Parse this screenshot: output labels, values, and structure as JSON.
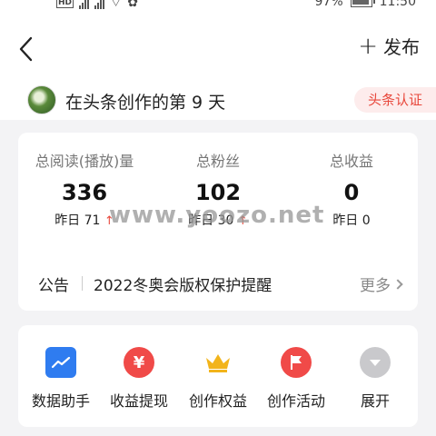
{
  "status": {
    "battery": "97%",
    "time": "11:50"
  },
  "header": {
    "publish_label": "发布"
  },
  "day": {
    "text": "在头条创作的第 9 天",
    "badge": "头条认证"
  },
  "stats": [
    {
      "label": "总阅读(播放)量",
      "value": "336",
      "sub_prefix": "昨日 71"
    },
    {
      "label": "总粉丝",
      "value": "102",
      "sub_prefix": "昨日 30"
    },
    {
      "label": "总收益",
      "value": "0",
      "sub_prefix": "昨日 0"
    }
  ],
  "notice": {
    "label": "公告",
    "text": "2022冬奥会版权保护提醒",
    "more": "更多"
  },
  "watermark": "www.yoozo.net",
  "tools": [
    {
      "label": "数据助手",
      "icon": "chart-icon"
    },
    {
      "label": "收益提现",
      "icon": "yuan-icon"
    },
    {
      "label": "创作权益",
      "icon": "crown-icon"
    },
    {
      "label": "创作活动",
      "icon": "flag-icon"
    },
    {
      "label": "展开",
      "icon": "expand-icon"
    }
  ],
  "colors": {
    "accent_red": "#e8473b",
    "blue": "#2f7cf0",
    "gold": "#f2b41b"
  }
}
